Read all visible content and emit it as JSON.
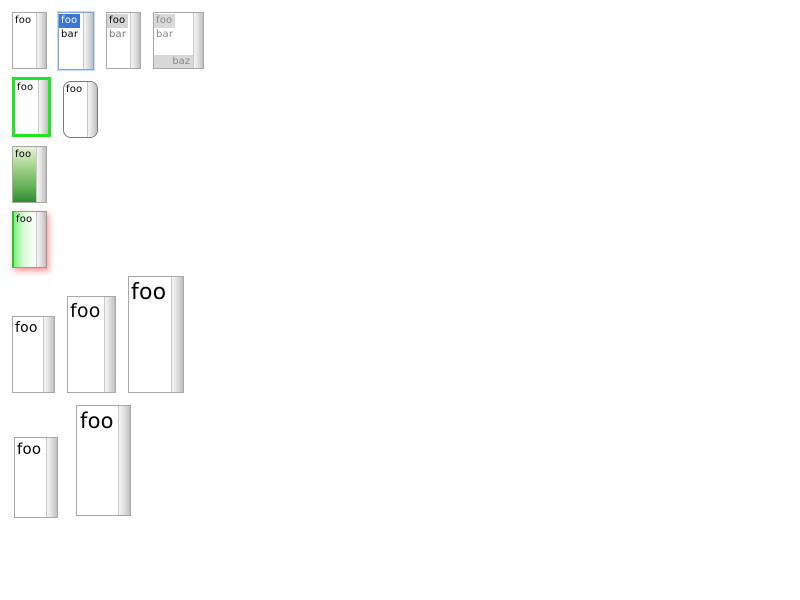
{
  "listboxes": {
    "plain": {
      "items": [
        "foo"
      ]
    },
    "focused": {
      "items": [
        "foo",
        "bar"
      ],
      "selected": "foo"
    },
    "disabled_selected": {
      "items": [
        "foo",
        "bar"
      ],
      "selected": "foo"
    },
    "disabled": {
      "items": [
        "foo",
        "bar"
      ],
      "last_item": "baz"
    },
    "thick_border": {
      "items": [
        "foo"
      ],
      "border_color": "#22e522"
    },
    "rounded": {
      "items": [
        "foo"
      ]
    },
    "gradient": {
      "items": [
        "foo"
      ],
      "gradient_colors": [
        "#e6f2d8",
        "#2e8c33"
      ]
    },
    "glow": {
      "items": [
        "foo"
      ],
      "shadow_color": "#ff5a5a",
      "accent_color": "#2cc12c"
    },
    "large_1": {
      "items": [
        "foo"
      ]
    },
    "large_2": {
      "items": [
        "foo"
      ]
    },
    "large_3": {
      "items": [
        "foo"
      ]
    },
    "large_4": {
      "items": [
        "foo"
      ]
    },
    "large_5": {
      "items": [
        "foo"
      ]
    }
  }
}
